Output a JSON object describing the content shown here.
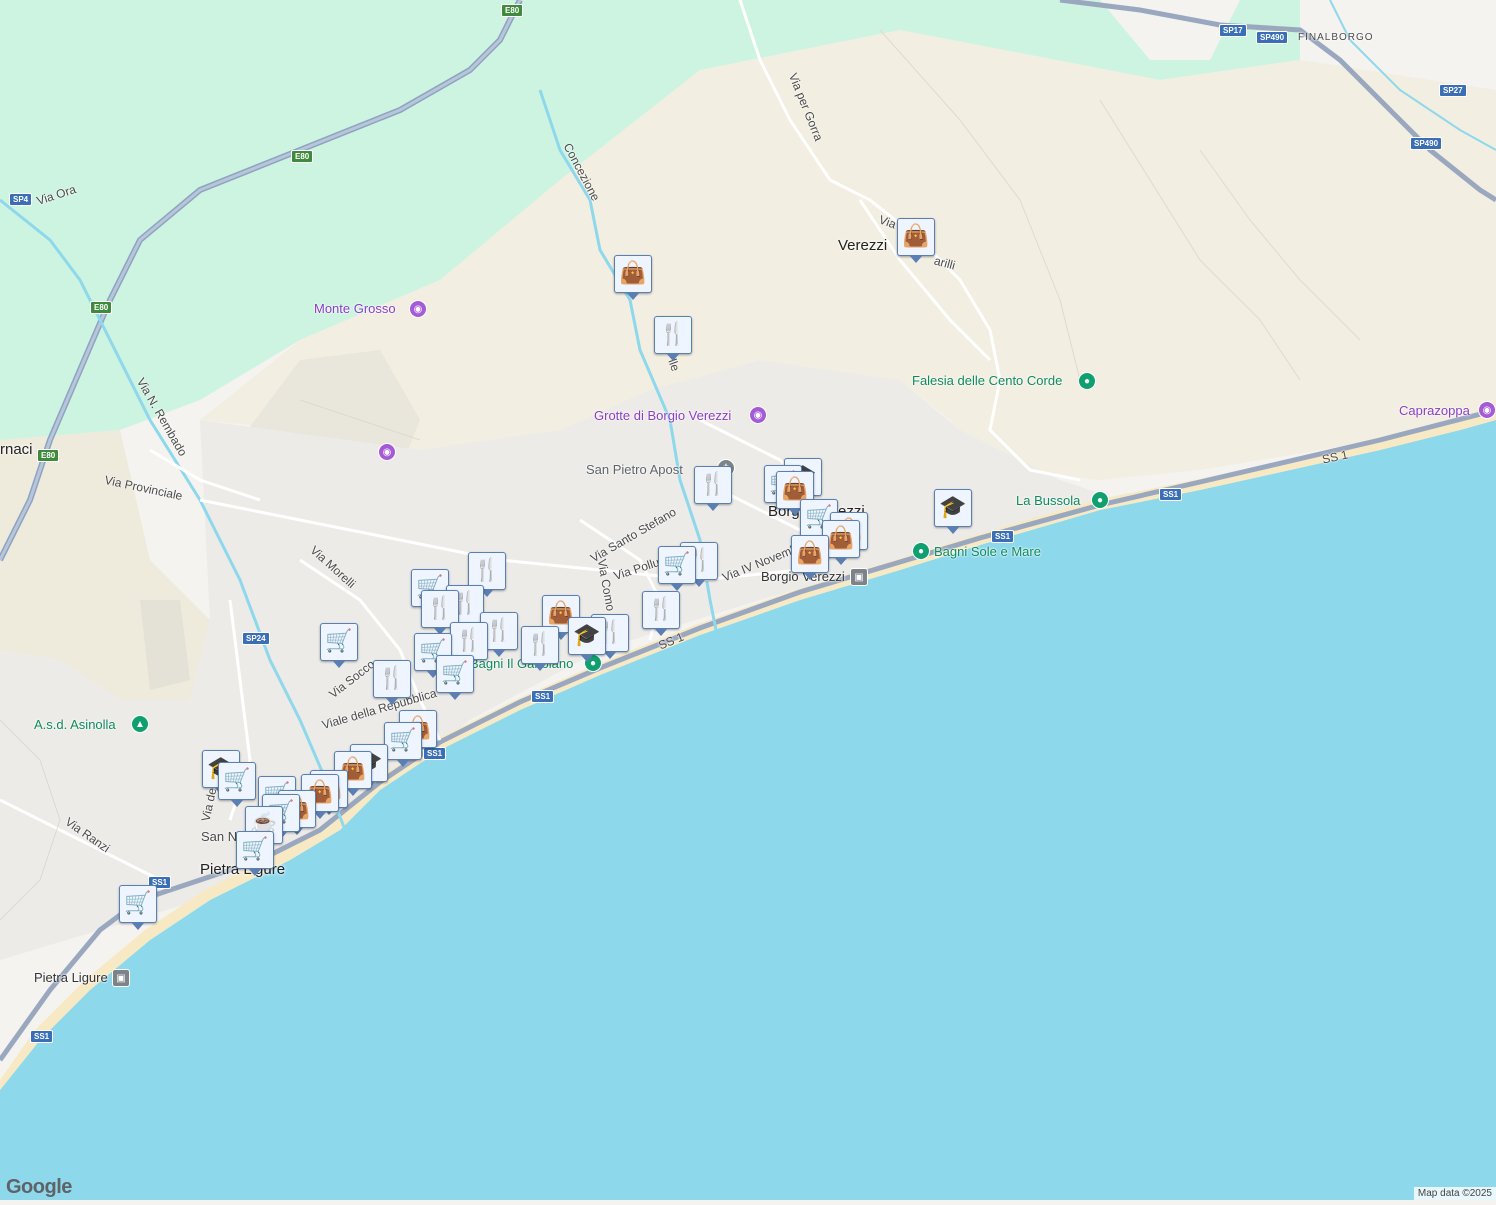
{
  "map": {
    "place_labels": [
      {
        "id": "verezzi",
        "text": "Verezzi"
      },
      {
        "id": "borgio-verezzi",
        "text": "Borgio Verezzi"
      },
      {
        "id": "pietra-ligure",
        "text": "Pietra Ligure"
      },
      {
        "id": "fornaci",
        "text": "rnaci"
      },
      {
        "id": "finalborgo",
        "text": "FINALBORGO"
      }
    ],
    "street_labels": [
      {
        "id": "via-ora",
        "text": "Via Ora"
      },
      {
        "id": "concezione",
        "text": "Concezione"
      },
      {
        "id": "via-per-gorra",
        "text": "Via per Gorra"
      },
      {
        "id": "via-n-rembado",
        "text": "Via N. Rembado"
      },
      {
        "id": "via-provinciale",
        "text": "Via Provinciale"
      },
      {
        "id": "via-morelli",
        "text": "Via Morelli"
      },
      {
        "id": "via-santo-stefano",
        "text": "Via Santo Stefano"
      },
      {
        "id": "via-como",
        "text": "Via Como"
      },
      {
        "id": "via-pollupice",
        "text": "Via Pollu"
      },
      {
        "id": "via-iv-novembre",
        "text": "Via IV Novemb"
      },
      {
        "id": "via-soccorso",
        "text": "Via Socco"
      },
      {
        "id": "viale-della-repubblica",
        "text": "Viale della Repubblica"
      },
      {
        "id": "via-ranzi",
        "text": "Via Ranzi"
      },
      {
        "id": "via-delle",
        "text": "Via dell"
      },
      {
        "id": "via-parilli",
        "text": "Via"
      },
      {
        "id": "via-parilli-2",
        "text": "arilli"
      },
      {
        "id": "ss1-road-a",
        "text": "SS 1"
      },
      {
        "id": "ss1-road-b",
        "text": "SS 1"
      },
      {
        "id": "via-mazzini-partial",
        "text": "lle"
      },
      {
        "id": "san-nicolo-partial",
        "text": "San N"
      }
    ],
    "poi_labels": [
      {
        "id": "monte-grosso",
        "text": "Monte Grosso",
        "kind": "purple"
      },
      {
        "id": "grotte-di-borgio-verezzi",
        "text": "Grotte di Borgio Verezzi",
        "kind": "purple"
      },
      {
        "id": "caprazoppa",
        "text": "Caprazoppa",
        "kind": "purple"
      },
      {
        "id": "falesia-delle-cento-corde",
        "text": "Falesia delle Cento Corde",
        "kind": "green"
      },
      {
        "id": "la-bussola",
        "text": "La Bussola",
        "kind": "green"
      },
      {
        "id": "bagni-sole-e-mare",
        "text": "Bagni Sole e Mare",
        "kind": "green"
      },
      {
        "id": "bagni-il-gabbiano",
        "text": "Bagni Il Gabbiano",
        "kind": "green"
      },
      {
        "id": "asd-asinolla",
        "text": "A.s.d. Asinolla",
        "kind": "green"
      },
      {
        "id": "san-pietro-apostolo",
        "text": "San Pietro Apost",
        "kind": "gray"
      },
      {
        "id": "borgio-verezzi-station",
        "text": "Borgio Verezzi",
        "kind": "station"
      },
      {
        "id": "pietra-ligure-station",
        "text": "Pietra Ligure",
        "kind": "station"
      }
    ],
    "road_shields": [
      {
        "text": "E80",
        "type": "e"
      },
      {
        "text": "E80",
        "type": "e"
      },
      {
        "text": "E80",
        "type": "e"
      },
      {
        "text": "E80",
        "type": "e"
      },
      {
        "text": "SP4",
        "type": "sp"
      },
      {
        "text": "SP24",
        "type": "sp"
      },
      {
        "text": "SP17",
        "type": "sp"
      },
      {
        "text": "SP490",
        "type": "sp"
      },
      {
        "text": "SP27",
        "type": "sp"
      },
      {
        "text": "SP490",
        "type": "sp"
      },
      {
        "text": "SS1",
        "type": "sp"
      },
      {
        "text": "SS1",
        "type": "sp"
      },
      {
        "text": "SS1",
        "type": "sp"
      },
      {
        "text": "SS1",
        "type": "sp"
      },
      {
        "text": "SS1",
        "type": "sp"
      },
      {
        "text": "SS1",
        "type": "sp"
      }
    ],
    "marker_types": {
      "shop": "shopping-bag-icon",
      "restaurant": "fork-knife-icon",
      "supermarket": "shopping-cart-icon",
      "school": "graduation-cap-icon",
      "cafe": "coffee-cup-icon"
    },
    "colors": {
      "sea": "#8ed8ec",
      "land": "#f4f3f0",
      "forest": "#c9f2df",
      "hills": "#f1ede0",
      "highway": "#8ea3c1",
      "pin_icon": "#0d3b66"
    }
  },
  "footer": {
    "logo": "Google",
    "attribution": "Map data ©2025"
  }
}
